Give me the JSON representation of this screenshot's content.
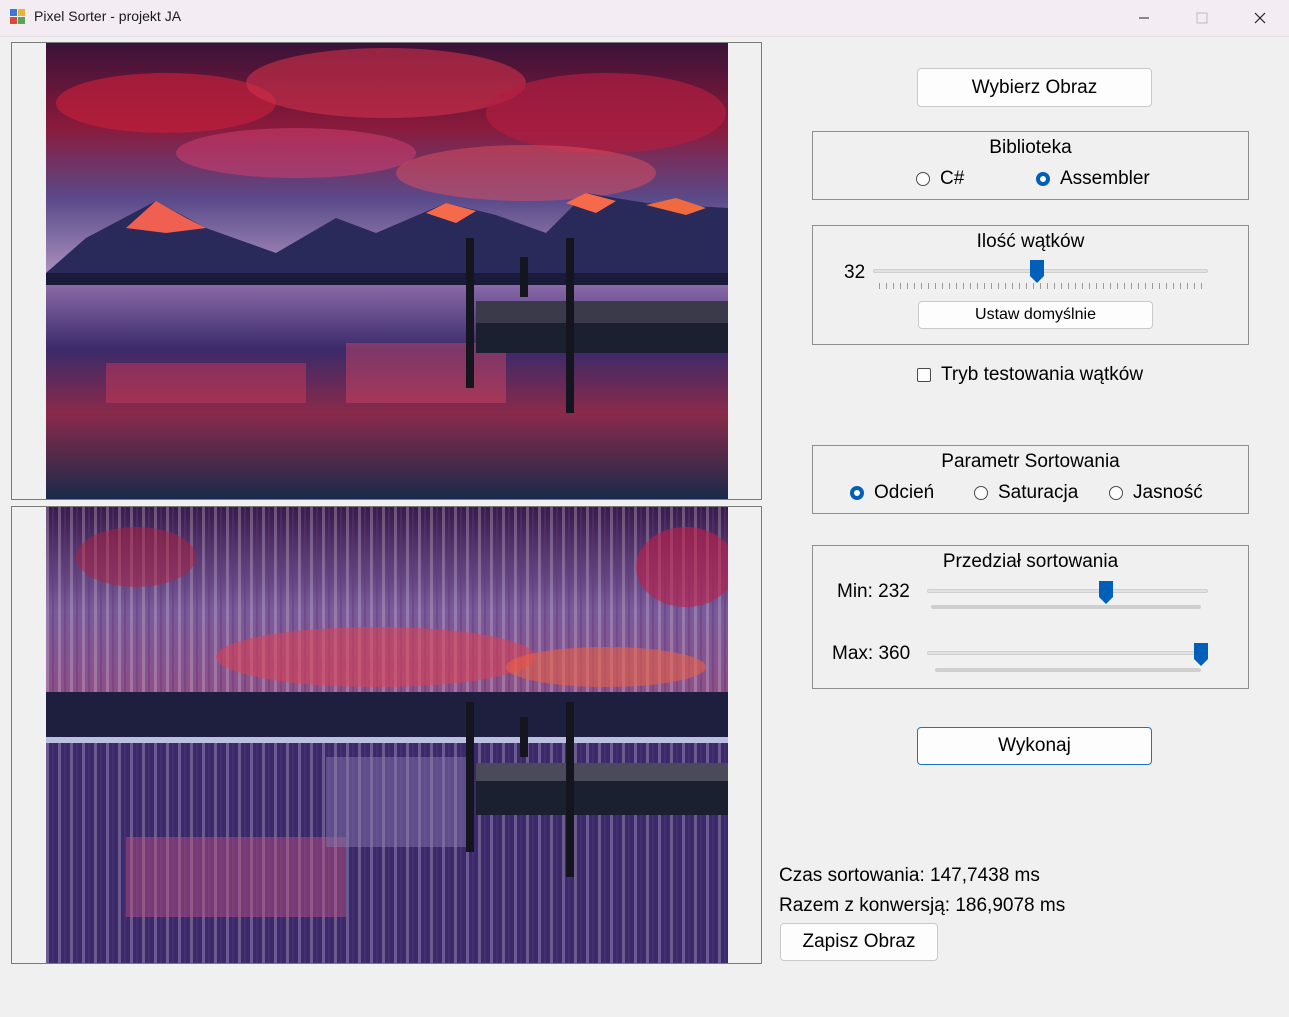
{
  "window": {
    "title": "Pixel Sorter - projekt JA"
  },
  "buttons": {
    "choose_image": "Wybierz Obraz",
    "set_default": "Ustaw domyślnie",
    "execute": "Wykonaj",
    "save_image": "Zapisz Obraz"
  },
  "library": {
    "title": "Biblioteka",
    "options": [
      {
        "label": "C#",
        "selected": false
      },
      {
        "label": "Assembler",
        "selected": true
      }
    ]
  },
  "threads": {
    "title": "Ilość wątków",
    "value": "32",
    "fraction": 0.49
  },
  "thread_test_mode": {
    "label": "Tryb testowania wątków",
    "checked": false
  },
  "sort_param": {
    "title": "Parametr Sortowania",
    "options": [
      {
        "label": "Odcień",
        "selected": true
      },
      {
        "label": "Saturacja",
        "selected": false
      },
      {
        "label": "Jasność",
        "selected": false
      }
    ]
  },
  "sort_range": {
    "title": "Przedział sortowania",
    "min_label": "Min: 232",
    "max_label": "Max: 360",
    "min_fraction": 0.644,
    "max_fraction": 1.0
  },
  "results": {
    "sort_time": "Czas sortowania: 147,7438 ms",
    "total_time": "Razem z konwersją: 186,9078 ms"
  },
  "colors": {
    "accent": "#005fb8",
    "window_bg": "#f0f0f0"
  }
}
